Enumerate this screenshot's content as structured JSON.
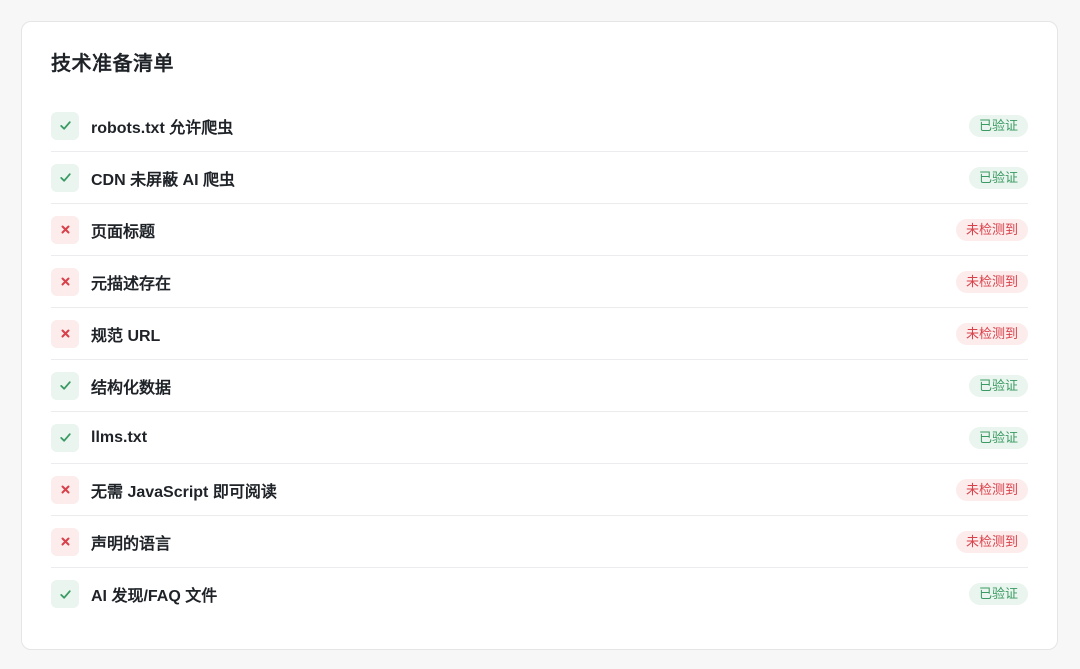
{
  "card": {
    "title": "技术准备清单"
  },
  "checklist": {
    "items": [
      {
        "label": "robots.txt 允许爬虫",
        "status": "ok",
        "badge": "已验证",
        "icon": "check-icon"
      },
      {
        "label": "CDN 未屏蔽 AI 爬虫",
        "status": "ok",
        "badge": "已验证",
        "icon": "check-icon"
      },
      {
        "label": "页面标题",
        "status": "fail",
        "badge": "未检测到",
        "icon": "cross-icon"
      },
      {
        "label": "元描述存在",
        "status": "fail",
        "badge": "未检测到",
        "icon": "cross-icon"
      },
      {
        "label": "规范 URL",
        "status": "fail",
        "badge": "未检测到",
        "icon": "cross-icon"
      },
      {
        "label": "结构化数据",
        "status": "ok",
        "badge": "已验证",
        "icon": "check-icon"
      },
      {
        "label": "llms.txt",
        "status": "ok",
        "badge": "已验证",
        "icon": "check-icon"
      },
      {
        "label": "无需 JavaScript 即可阅读",
        "status": "fail",
        "badge": "未检测到",
        "icon": "cross-icon"
      },
      {
        "label": "声明的语言",
        "status": "fail",
        "badge": "未检测到",
        "icon": "cross-icon"
      },
      {
        "label": "AI 发现/FAQ 文件",
        "status": "ok",
        "badge": "已验证",
        "icon": "check-icon"
      }
    ]
  },
  "colors": {
    "ok": "#3a9a63",
    "ok_bg": "#e9f5ee",
    "fail": "#d9414a",
    "fail_bg": "#fdecec"
  }
}
